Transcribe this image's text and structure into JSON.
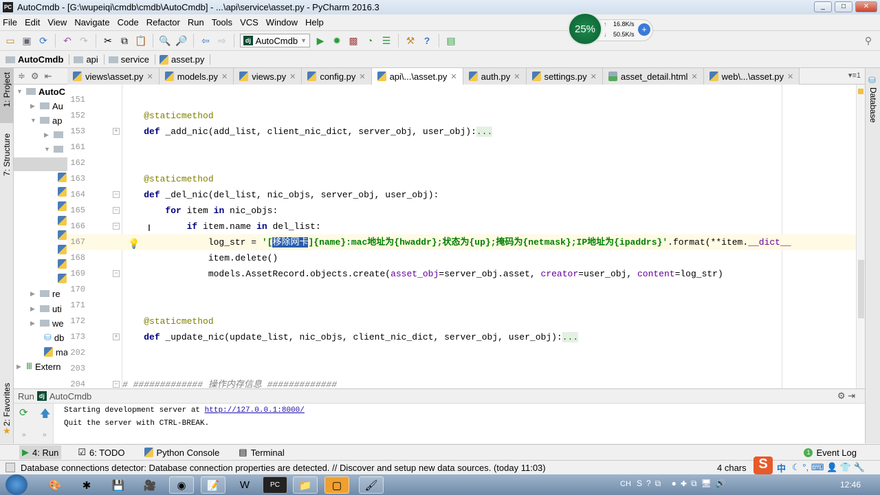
{
  "window": {
    "title": "AutoCmdb - [G:\\wupeiqi\\cmdb\\cmdb\\AutoCmdb] - ...\\api\\service\\asset.py - PyCharm 2016.3",
    "app_icon": "PC"
  },
  "menu": [
    "File",
    "Edit",
    "View",
    "Navigate",
    "Code",
    "Refactor",
    "Run",
    "Tools",
    "VCS",
    "Window",
    "Help"
  ],
  "toolbar": {
    "run_config": "AutoCmdb",
    "dj_badge": "dj"
  },
  "breadcrumb": [
    "AutoCmdb",
    "api",
    "service",
    "asset.py"
  ],
  "left_tools": {
    "project": "1: Project",
    "structure": "7: Structure",
    "favorites": "2: Favorites"
  },
  "right_tools": {
    "database": "Database"
  },
  "tree": [
    "AutoC",
    "Au",
    "ap",
    "",
    "",
    "",
    "re",
    "uti",
    "we",
    "db",
    "ma",
    "Extern"
  ],
  "tabs": [
    {
      "label": "views\\asset.py",
      "active": false
    },
    {
      "label": "models.py",
      "active": false
    },
    {
      "label": "views.py",
      "active": false
    },
    {
      "label": "config.py",
      "active": false
    },
    {
      "label": "api\\...\\asset.py",
      "active": true
    },
    {
      "label": "auth.py",
      "active": false
    },
    {
      "label": "settings.py",
      "active": false
    },
    {
      "label": "asset_detail.html",
      "active": false
    },
    {
      "label": "web\\...\\asset.py",
      "active": false
    }
  ],
  "tab_count": "1",
  "code_lines": [
    {
      "n": "151",
      "segs": []
    },
    {
      "n": "152",
      "segs": [
        [
          "    ",
          ""
        ],
        [
          "@staticmethod",
          "dec"
        ]
      ]
    },
    {
      "n": "153",
      "fold": "+",
      "segs": [
        [
          "    ",
          ""
        ],
        [
          "def",
          "kw"
        ],
        [
          " _add_nic(add_list, client_nic_dict, server_obj, user_obj):",
          ""
        ],
        [
          "...",
          "fld"
        ]
      ]
    },
    {
      "n": "161",
      "segs": []
    },
    {
      "n": "162",
      "segs": []
    },
    {
      "n": "163",
      "segs": [
        [
          "    ",
          ""
        ],
        [
          "@staticmethod",
          "dec"
        ]
      ]
    },
    {
      "n": "164",
      "fold": "-",
      "segs": [
        [
          "    ",
          ""
        ],
        [
          "def",
          "kw"
        ],
        [
          " _del_nic(del_list, nic_objs, server_obj, user_obj):",
          ""
        ]
      ]
    },
    {
      "n": "165",
      "fold": "-",
      "segs": [
        [
          "        ",
          ""
        ],
        [
          "for",
          "kw"
        ],
        [
          " item ",
          ""
        ],
        [
          "in",
          "kw"
        ],
        [
          " nic_objs:",
          ""
        ]
      ]
    },
    {
      "n": "166",
      "fold": "-",
      "segs": [
        [
          "            ",
          ""
        ],
        [
          "if",
          "kw"
        ],
        [
          " item.name ",
          ""
        ],
        [
          "in",
          "kw"
        ],
        [
          " del_list:",
          ""
        ]
      ]
    },
    {
      "n": "167",
      "current": true,
      "segs": [
        [
          "                log_str = ",
          ""
        ],
        [
          "'[",
          "str"
        ],
        [
          "移除网卡",
          "sel"
        ],
        [
          "]{name}:mac地址为{hwaddr};状态为{up};掩码为{netmask};IP地址为{ipaddrs}'",
          "str"
        ],
        [
          ".format(**item.",
          ""
        ],
        [
          "__dict__",
          "prm"
        ]
      ]
    },
    {
      "n": "168",
      "segs": [
        [
          "                item.delete()",
          ""
        ]
      ]
    },
    {
      "n": "169",
      "fold": "-",
      "segs": [
        [
          "                models.AssetRecord.objects.create(",
          ""
        ],
        [
          "asset_obj",
          "prm"
        ],
        [
          "=server_obj.asset, ",
          ""
        ],
        [
          "creator",
          "prm"
        ],
        [
          "=user_obj, ",
          ""
        ],
        [
          "content",
          "prm"
        ],
        [
          "=log_str)",
          ""
        ]
      ]
    },
    {
      "n": "170",
      "segs": []
    },
    {
      "n": "171",
      "segs": []
    },
    {
      "n": "172",
      "segs": [
        [
          "    ",
          ""
        ],
        [
          "@staticmethod",
          "dec"
        ]
      ]
    },
    {
      "n": "173",
      "fold": "+",
      "segs": [
        [
          "    ",
          ""
        ],
        [
          "def",
          "kw"
        ],
        [
          " _update_nic(update_list, nic_objs, client_nic_dict, server_obj, user_obj):",
          ""
        ],
        [
          "...",
          "fld"
        ]
      ]
    },
    {
      "n": "202",
      "segs": []
    },
    {
      "n": "203",
      "segs": []
    },
    {
      "n": "204",
      "fold": "-",
      "segs": [
        [
          "# ############# 操作内存信息 #############",
          "cm"
        ]
      ]
    }
  ],
  "run_panel": {
    "label": "Run",
    "config": "AutoCmdb",
    "line1_prefix": "Starting development server at ",
    "line1_link": "http://127.0.0.1:8000/",
    "line2": "Quit the server with CTRL-BREAK."
  },
  "bottom_tabs": [
    "4: Run",
    "6: TODO",
    "Python Console",
    "Terminal"
  ],
  "event_log": {
    "label": "Event Log",
    "count": "1"
  },
  "status": {
    "message": "Database connections detector: Database connection properties are detected. // Discover and setup new data sources. (today 11:03)",
    "chars": "4 chars"
  },
  "ime": {
    "logo": "S",
    "mode": "中"
  },
  "net_widget": {
    "percent": "25%",
    "up": "16.8K/s",
    "down": "50.5K/s"
  },
  "taskbar": {
    "lang": "CH",
    "clock": "12:46"
  },
  "colors": {
    "keyword": "#000080",
    "decorator": "#808000",
    "string": "#008000",
    "selection": "#2a5dab",
    "current_line": "#fffae3"
  }
}
